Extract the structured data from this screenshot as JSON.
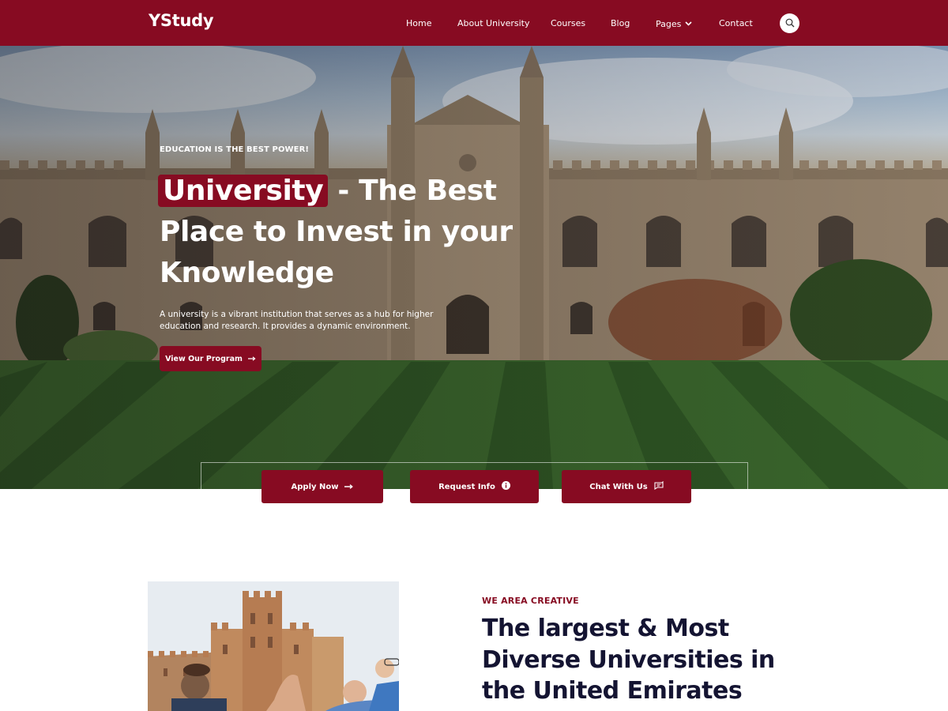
{
  "brand": {
    "name": "YStudy",
    "accent": "#870b22"
  },
  "nav": {
    "items": [
      "Home",
      "About University",
      "Courses",
      "Blog",
      "Pages",
      "Contact"
    ],
    "search_icon": "search-icon",
    "pages_icon": "chevron-down-icon"
  },
  "hero": {
    "kicker": "EDUCATION IS THE BEST POWER!",
    "headline_highlight": "University",
    "headline_rest": " - The Best Place to Invest in your Knowledge",
    "description": "A university is a vibrant institution that serves as a hub for higher education and research. It provides a dynamic environment.",
    "cta_label": "View Our Program",
    "cta_icon": "arrow-right-icon"
  },
  "actions": [
    {
      "label": "Apply Now",
      "icon": "arrow-right-icon"
    },
    {
      "label": "Request Info",
      "icon": "info-icon"
    },
    {
      "label": "Chat With Us",
      "icon": "chat-icon"
    }
  ],
  "about": {
    "eyebrow": "WE AREA CREATIVE",
    "title": "The largest & Most Diverse Universities in the United Emirates"
  }
}
